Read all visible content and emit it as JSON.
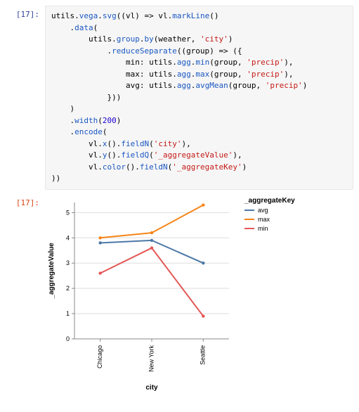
{
  "prompt_in": "[17]:",
  "prompt_out": "[17]:",
  "code": {
    "l1a": "utils",
    "l1b": "vega",
    "l1c": "svg",
    "l1d": "vl",
    "l1e": "vl",
    "l1f": "markLine",
    "l2a": "data",
    "l3a": "utils",
    "l3b": "group",
    "l3c": "by",
    "l3d": "weather",
    "l3e": "'city'",
    "l4a": "reduceSeparate",
    "l4b": "group",
    "l5a": "min",
    "l5b": "utils",
    "l5c": "agg",
    "l5d": "min",
    "l5e": "group",
    "l5f": "'precip'",
    "l6a": "max",
    "l6b": "utils",
    "l6c": "agg",
    "l6d": "max",
    "l6e": "group",
    "l6f": "'precip'",
    "l7a": "avg",
    "l7b": "utils",
    "l7c": "agg",
    "l7d": "avgMean",
    "l7e": "group",
    "l7f": "'precip'",
    "l10a": "width",
    "l10b": "200",
    "l11a": "encode",
    "l12a": "vl",
    "l12b": "x",
    "l12c": "fieldN",
    "l12d": "'city'",
    "l13a": "vl",
    "l13b": "y",
    "l13c": "fieldQ",
    "l13d": "'_aggregateValue'",
    "l14a": "vl",
    "l14b": "color",
    "l14c": "fieldN",
    "l14d": "'_aggregateKey'"
  },
  "chart_data": {
    "type": "line",
    "title": "",
    "xlabel": "city",
    "ylabel": "_aggregateValue",
    "legend_title": "_aggregateKey",
    "categories": [
      "Chicago",
      "New York",
      "Seattle"
    ],
    "series": [
      {
        "name": "avg",
        "values": [
          3.8,
          3.9,
          3.0
        ],
        "color": "#4c78a8"
      },
      {
        "name": "max",
        "values": [
          4.0,
          4.2,
          5.3
        ],
        "color": "#f58518"
      },
      {
        "name": "min",
        "values": [
          2.6,
          3.6,
          0.9
        ],
        "color": "#e45756"
      }
    ],
    "ylim": [
      0,
      5
    ],
    "yticks": [
      0,
      1,
      2,
      3,
      4,
      5
    ]
  }
}
